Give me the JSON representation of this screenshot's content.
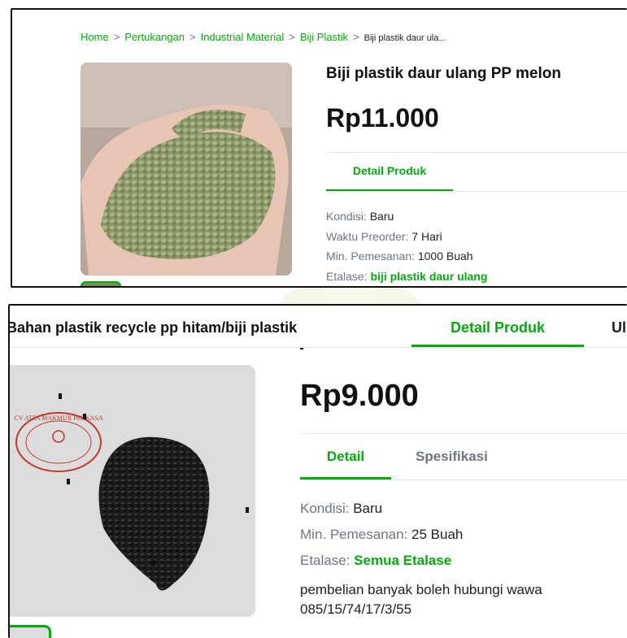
{
  "panel1": {
    "breadcrumb": [
      "Home",
      "Pertukangan",
      "Industrial Material",
      "Biji Plastik"
    ],
    "breadcrumb_separator": ">",
    "breadcrumb_current": "Biji plastik daur ula...",
    "title": "Biji plastik daur ulang PP melon",
    "price": "Rp11.000",
    "tab": "Detail Produk",
    "specs": {
      "kondisi_label": "Kondisi: ",
      "kondisi_value": "Baru",
      "preorder_label": "Waktu Preorder: ",
      "preorder_value": "7 Hari",
      "min_label": "Min. Pemesanan: ",
      "min_value": "1000 Buah",
      "etalase_label": "Etalase: ",
      "etalase_value": "biji plastik daur ulang"
    }
  },
  "panel2": {
    "header_title": "Bahan plastik recycle pp hitam/biji plastik",
    "header_tab_active": "Detail Produk",
    "header_tab_next": "Ul",
    "price": "Rp9.000",
    "tabs": [
      "Detail",
      "Spesifikasi"
    ],
    "specs": {
      "kondisi_label": "Kondisi: ",
      "kondisi_value": "Baru",
      "min_label": "Min. Pemesanan: ",
      "min_value": "25 Buah",
      "etalase_label": "Etalase: ",
      "etalase_value": "Semua Etalase"
    },
    "description": "pembelian banyak boleh hubungi wawa 085/15/74/17/3/55",
    "stamp_text": "CV ATTA MAKMUR PERKASA"
  },
  "colors": {
    "accent": "#03ac0e",
    "text": "#212121",
    "muted": "#6d7588"
  }
}
